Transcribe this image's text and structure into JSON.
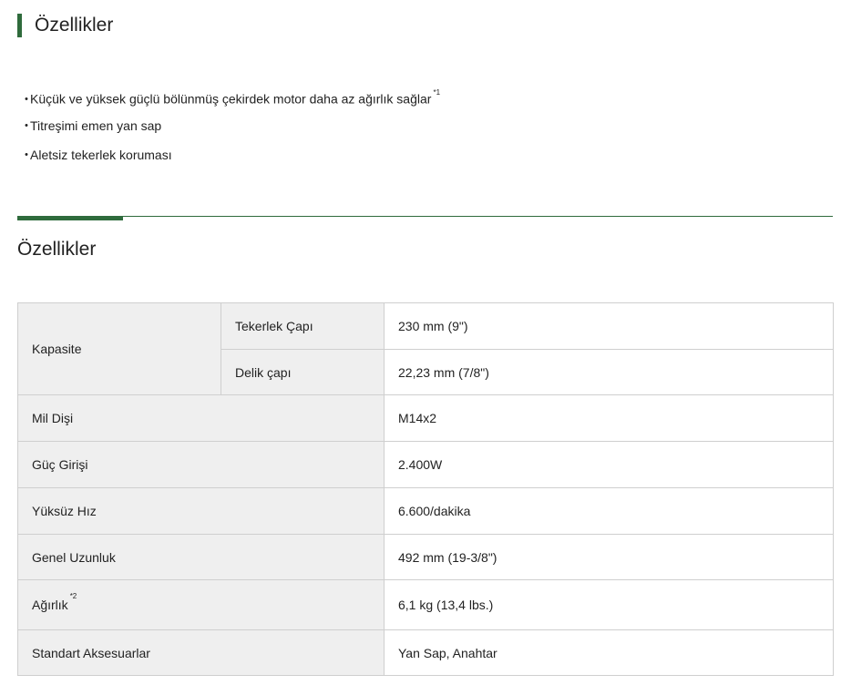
{
  "header": {
    "title": "Özellikler"
  },
  "features": [
    {
      "text": "Küçük ve yüksek güçlü bölünmüş çekirdek motor daha az ağırlık sağlar",
      "note": "*1"
    },
    {
      "text": "Titreşimi emen yan sap",
      "note": ""
    },
    {
      "text": "Aletsiz tekerlek koruması",
      "note": ""
    }
  ],
  "bullet": "・",
  "spec": {
    "heading": "Özellikler",
    "capacity_label": "Kapasite",
    "wheel_diameter_label": "Tekerlek Çapı",
    "wheel_diameter_value": "230 mm (9\")",
    "hole_diameter_label": "Delik çapı",
    "hole_diameter_value": "22,23 mm (7/8\")",
    "spindle_label": "Mil Dişi",
    "spindle_value": "M14x2",
    "power_label": "Güç Girişi",
    "power_value": "2.400W",
    "speed_label": "Yüksüz Hız",
    "speed_value": "6.600/dakika",
    "length_label": "Genel Uzunluk",
    "length_value": "492 mm (19-3/8\")",
    "weight_label": "Ağırlık",
    "weight_note": "*2",
    "weight_value": "6,1 kg (13,4 lbs.)",
    "accessories_label": "Standart Aksesuarlar",
    "accessories_value": "Yan Sap, Anahtar"
  },
  "colors": {
    "accent": "#2f6b3c",
    "label_bg": "#efefef",
    "border": "#cfcfcf"
  }
}
